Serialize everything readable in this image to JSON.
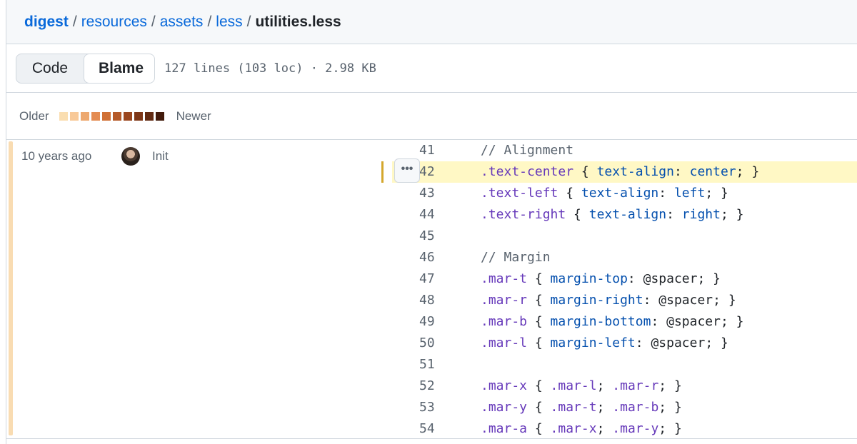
{
  "breadcrumb": {
    "root": "digest",
    "parts": [
      "resources",
      "assets",
      "less"
    ],
    "file": "utilities.less"
  },
  "toolbar": {
    "code_label": "Code",
    "blame_label": "Blame",
    "file_info": "127 lines (103 loc) · 2.98 KB"
  },
  "legend": {
    "older": "Older",
    "newer": "Newer",
    "colors": [
      "#fadeb1",
      "#f8c998",
      "#eda86f",
      "#e48c52",
      "#d07035",
      "#b55a29",
      "#9b471f",
      "#7e3718",
      "#622a12",
      "#421a0b"
    ]
  },
  "commit": {
    "time": "10 years ago",
    "message": "Init",
    "age_color": "#f9dcb2"
  },
  "highlight_color": "#fff8c5",
  "lines": [
    {
      "n": "41",
      "text": "// Alignment"
    },
    {
      "n": "42",
      "text": ".text-center { text-align: center; }"
    },
    {
      "n": "43",
      "text": ".text-left { text-align: left; }"
    },
    {
      "n": "44",
      "text": ".text-right { text-align: right; }"
    },
    {
      "n": "45",
      "text": ""
    },
    {
      "n": "46",
      "text": "// Margin"
    },
    {
      "n": "47",
      "text": ".mar-t { margin-top: @spacer; }"
    },
    {
      "n": "48",
      "text": ".mar-r { margin-right: @spacer; }"
    },
    {
      "n": "49",
      "text": ".mar-b { margin-bottom: @spacer; }"
    },
    {
      "n": "50",
      "text": ".mar-l { margin-left: @spacer; }"
    },
    {
      "n": "51",
      "text": ""
    },
    {
      "n": "52",
      "text": ".mar-x { .mar-l; .mar-r; }"
    },
    {
      "n": "53",
      "text": ".mar-y { .mar-t; .mar-b; }"
    },
    {
      "n": "54",
      "text": ".mar-a { .mar-x; .mar-y; }"
    }
  ],
  "icons": {
    "more_button": "kebab-horizontal-icon",
    "avatar": "user-avatar"
  }
}
